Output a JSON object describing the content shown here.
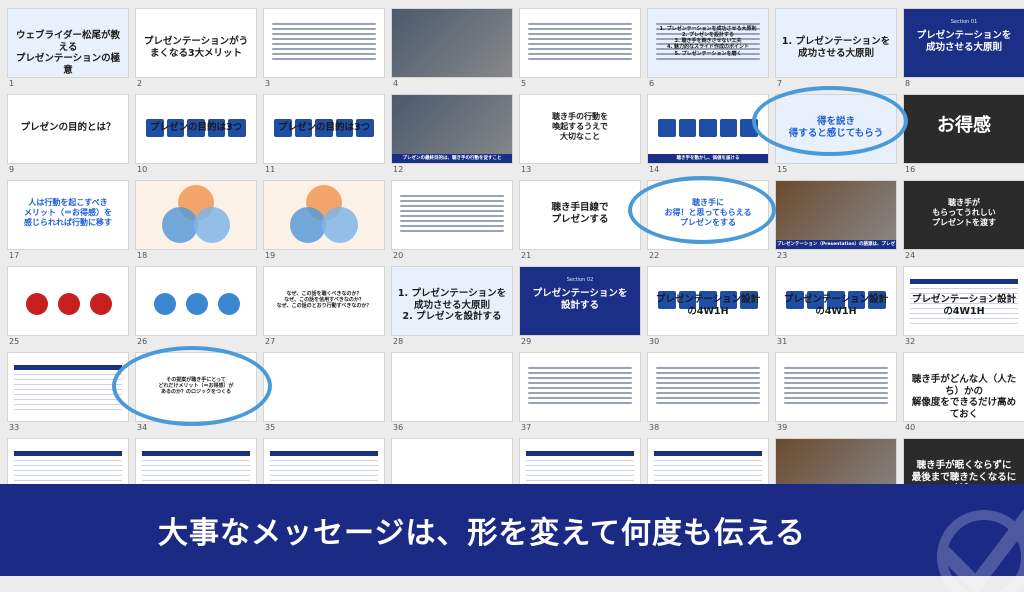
{
  "banner": {
    "message": "大事なメッセージは、形を変えて何度も伝える"
  },
  "slides": [
    {
      "num": "1",
      "title": "ウェブライダー松尾が教える\nプレゼンテーションの極意",
      "sub": "",
      "style": "lightblue"
    },
    {
      "num": "2",
      "title": "プレゼンテーションがうまくなる3大メリット",
      "sub": "",
      "style": "white"
    },
    {
      "num": "3",
      "title": "",
      "sub": "",
      "style": "white"
    },
    {
      "num": "4",
      "title": "",
      "sub": "",
      "style": "photo"
    },
    {
      "num": "5",
      "title": "",
      "sub": "",
      "style": "white"
    },
    {
      "num": "6",
      "title": "1. プレゼンテーションを成功させる大原則\n2. プレゼンを設計する\n3. 聴き手を飽きさせない工夫\n4. 魅力的なスライド作成のポイント\n5. プレゼンテーションを磨く",
      "sub": "",
      "style": "lightblue"
    },
    {
      "num": "7",
      "title": "1. プレゼンテーションを成功させる大原則",
      "sub": "",
      "style": "lightblue"
    },
    {
      "num": "8",
      "title": "プレゼンテーションを\n成功させる大原則",
      "sub": "Section 01",
      "style": "navy"
    },
    {
      "num": "9",
      "title": "プレゼンの目的とは？",
      "sub": "",
      "style": "white"
    },
    {
      "num": "10",
      "title": "プレゼンの目的は3つ",
      "sub": "",
      "style": "white"
    },
    {
      "num": "11",
      "title": "プレゼンの目的は3つ",
      "sub": "",
      "style": "white"
    },
    {
      "num": "12",
      "title": "",
      "sub": "プレゼンの最終目的は、聴き手の行動を促すこと",
      "style": "photo"
    },
    {
      "num": "13",
      "title": "聴き手の行動を\n喚起するうえで\n大切なこと",
      "sub": "",
      "style": "white"
    },
    {
      "num": "14",
      "title": "",
      "sub": "聴き手を動かし、価値を届ける",
      "style": "white"
    },
    {
      "num": "15",
      "title": "得を説き\n得すると感じてもらう",
      "sub": "",
      "style": "lightblue"
    },
    {
      "num": "16",
      "title": "お得感",
      "sub": "",
      "style": "dark"
    },
    {
      "num": "17",
      "title": "人は行動を起こすべき\nメリット（＝お得感）を\n感じられれば行動に移す",
      "sub": "",
      "style": "white"
    },
    {
      "num": "18",
      "title": "",
      "sub": "",
      "style": "venn"
    },
    {
      "num": "19",
      "title": "",
      "sub": "",
      "style": "venn2"
    },
    {
      "num": "20",
      "title": "",
      "sub": "",
      "style": "white"
    },
    {
      "num": "21",
      "title": "聴き手目線で\nプレゼンする",
      "sub": "",
      "style": "white"
    },
    {
      "num": "22",
      "title": "聴き手に\nお得！と思ってもらえる\nプレゼンをする",
      "sub": "",
      "style": "white"
    },
    {
      "num": "23",
      "title": "",
      "sub": "プレゼンテーション（Presentation）の語源は、プレゼント",
      "style": "photo"
    },
    {
      "num": "24",
      "title": "聴き手が\nもらってうれしい\nプレゼントを渡す",
      "sub": "",
      "style": "dark"
    },
    {
      "num": "25",
      "title": "",
      "sub": "",
      "style": "white"
    },
    {
      "num": "26",
      "title": "",
      "sub": "",
      "style": "white"
    },
    {
      "num": "27",
      "title": "なぜ、この話を聴くべきなのか？\nなぜ、この話を信用すべきなのか？\nなぜ、この話のとおり行動すべきなのか？",
      "sub": "",
      "style": "white"
    },
    {
      "num": "28",
      "title": "1. プレゼンテーションを成功させる大原則\n2. プレゼンを設計する",
      "sub": "",
      "style": "lightblue"
    },
    {
      "num": "29",
      "title": "プレゼンテーションを\n設計する",
      "sub": "Section 02",
      "style": "navy"
    },
    {
      "num": "30",
      "title": "プレゼンテーション設計の4W1H",
      "sub": "",
      "style": "white"
    },
    {
      "num": "31",
      "title": "プレゼンテーション設計の4W1H",
      "sub": "",
      "style": "white"
    },
    {
      "num": "32",
      "title": "プレゼンテーション設計の4W1H",
      "sub": "",
      "style": "white"
    },
    {
      "num": "33",
      "title": "",
      "sub": "",
      "style": "white"
    },
    {
      "num": "34",
      "title": "その提案が聴き手にとって\nどれだけメリット（＝お得感）が\nあるのか？のロジックをつくる",
      "sub": "",
      "style": "white"
    },
    {
      "num": "35",
      "title": "",
      "sub": "",
      "style": "white"
    },
    {
      "num": "36",
      "title": "",
      "sub": "",
      "style": "white"
    },
    {
      "num": "37",
      "title": "",
      "sub": "",
      "style": "white"
    },
    {
      "num": "38",
      "title": "",
      "sub": "",
      "style": "white"
    },
    {
      "num": "39",
      "title": "",
      "sub": "",
      "style": "white"
    },
    {
      "num": "40",
      "title": "聴き手がどんな人（人たち）かの\n解像度をできるだけ高めておく",
      "sub": "",
      "style": "white"
    },
    {
      "num": "",
      "title": "",
      "sub": "",
      "style": "white"
    },
    {
      "num": "",
      "title": "",
      "sub": "",
      "style": "white"
    },
    {
      "num": "",
      "title": "",
      "sub": "",
      "style": "white"
    },
    {
      "num": "",
      "title": "",
      "sub": "",
      "style": "white"
    },
    {
      "num": "",
      "title": "",
      "sub": "",
      "style": "white"
    },
    {
      "num": "",
      "title": "",
      "sub": "",
      "style": "white"
    },
    {
      "num": "",
      "title": "",
      "sub": "",
      "style": "photo"
    },
    {
      "num": "",
      "title": "聴き手が眠くならずに\n最後まで聴きたくなるには？",
      "sub": "",
      "style": "dark"
    }
  ]
}
